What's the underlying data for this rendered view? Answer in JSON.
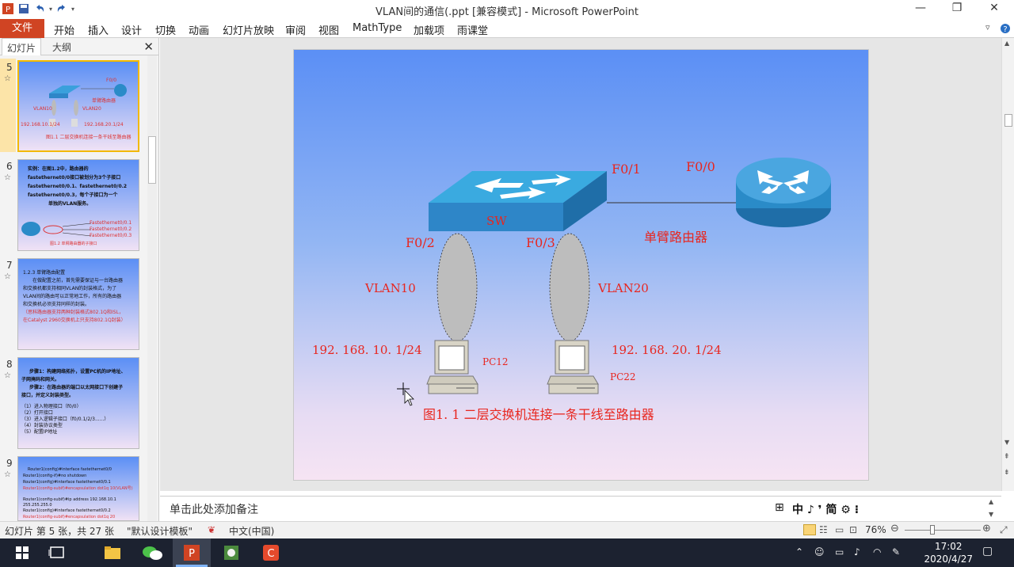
{
  "window": {
    "title": "VLAN间的通信(.ppt [兼容模式] - Microsoft PowerPoint",
    "minimize": "—",
    "restore": "❐",
    "close": "✕"
  },
  "ribbon": {
    "file": "文件",
    "tabs": [
      "开始",
      "插入",
      "设计",
      "切换",
      "动画",
      "幻灯片放映",
      "审阅",
      "视图",
      "MathType",
      "加载项",
      "雨课堂"
    ]
  },
  "panel": {
    "tab_slides": "幻灯片",
    "tab_outline": "大纲",
    "close": "✕",
    "slides": [
      {
        "num": "5",
        "lines": [
          "F0/0",
          "单臂路由器",
          "VLAN10",
          "VLAN20",
          "192.168.10.1/24",
          "192.168.20.1/24",
          "图1.1 二层交换机连接一条干线至路由器"
        ]
      },
      {
        "num": "6",
        "lines": [
          "实例：在图1.2中，路由器的",
          "fastethernet0/0接口被划分为3个子接口",
          "fastethernet0/0.1、fastethernet0/0.2",
          "fastethernet0/0.3，每个子接口为一个",
          "单独的VLAN服务。",
          "Fastethernet0/0.1",
          "Fastethernet0/0.2",
          "Fastethernet0/0.3",
          "图1.2 单臂路由器的子接口"
        ]
      },
      {
        "num": "7",
        "lines": [
          "1.2.3 单臂路由配置",
          "在做配置之前，首先需要保证与一台路由器",
          "和交换机都支持相同VLAN的封装格式，为了",
          "VLAN间的路由可以正常地工作，所有的路由器",
          "和交换机必须支持同样的封装。",
          "（思科路由器支持两种封装格式802.1Q和ISL，",
          "在Catalyst 2960交换机上只支持802.1Q封装）"
        ]
      },
      {
        "num": "8",
        "lines": [
          "步骤1：构建网络拓扑，设置PC机的IP地址、",
          "子网掩码和网关。",
          "步骤2：在路由器的端口以太网接口下创建子",
          "接口，并定义封装类型。",
          "（1）进入物理接口（f0/0）",
          "（2）打开接口",
          "（3）进入逻辑子接口（f0/0.1/2/3......）",
          "（4）封装协议类型",
          "（5）配置IP地址"
        ]
      },
      {
        "num": "9",
        "lines": [
          "Router1(config)#interface fastethernet0/0",
          "Router1(config-if)#no shutdown",
          "Router1(config)#interface fastethernet0/0.1",
          "Router1(config-subif)#encapsulation dot1q 10(VLAN号)",
          "Router1(config-subif)#ip address 192.168.10.1",
          "255.255.255.0",
          "Router1(config)#interface fastethernet0/0.2",
          "Router1(config-subif)#encapsulation dot1q 20"
        ]
      }
    ]
  },
  "slide": {
    "sw_label": "SW",
    "f01": "F0/1",
    "f00": "F0/0",
    "f02": "F0/2",
    "f03": "F0/3",
    "router_label": "单臂路由器",
    "vlan10": "VLAN10",
    "vlan20": "VLAN20",
    "ip1": "192. 168. 10. 1/24",
    "ip2": "192. 168. 20. 1/24",
    "pc1": "PC12",
    "pc2": "PC22",
    "caption": "图1. 1 二层交换机连接一条干线至路由器"
  },
  "notes": {
    "placeholder": "单击此处添加备注",
    "ime": "中 ♪ ❜ 简 ⚙ ⁝"
  },
  "status": {
    "slide_info": "幻灯片 第 5 张，共 27 张",
    "theme": "\"默认设计模板\"",
    "language": "中文(中国)",
    "zoom": "76%"
  },
  "taskbar": {
    "time": "17:02",
    "date": "2020/4/27"
  },
  "colors": {
    "file_tab": "#d04423",
    "slide_top": "#5b8ff5",
    "slide_bottom": "#f6e4f3",
    "diagram_text": "#e8261f",
    "switch": "#2e86c8"
  }
}
